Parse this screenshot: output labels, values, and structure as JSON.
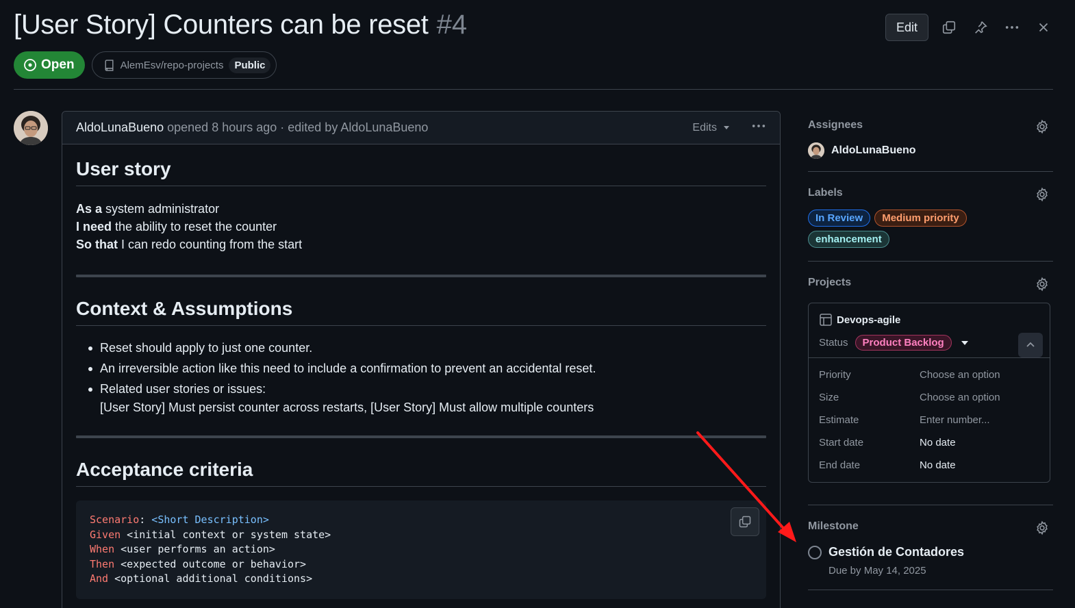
{
  "header": {
    "title": "[User Story] Counters can be reset",
    "number": "#4",
    "edit_label": "Edit",
    "state": "Open",
    "repo": "AlemEsv/repo-projects",
    "visibility": "Public"
  },
  "comment": {
    "author": "AldoLunaBueno",
    "meta": "opened 8 hours ago · edited by AldoLunaBueno",
    "edits_label": "Edits",
    "user_story": {
      "heading": "User story",
      "as_a_kw": "As a",
      "as_a": " system administrator",
      "i_need_kw": "I need",
      "i_need": " the ability to reset the counter",
      "so_that_kw": "So that",
      "so_that": " I can redo counting from the start"
    },
    "context": {
      "heading": "Context & Assumptions",
      "items": [
        "Reset should apply to just one counter.",
        "An irreversible action like this need to include a confirmation to prevent an accidental reset.",
        "Related user stories or issues:"
      ],
      "related": "[User Story] Must persist counter across restarts, [User Story] Must allow multiple counters"
    },
    "acceptance": {
      "heading": "Acceptance criteria",
      "code": {
        "l1_kw": "Scenario",
        "l1_colon": ":",
        "l1_rest": " <Short Description>",
        "l2_kw": "Given",
        "l2_rest": " <initial context or system state>",
        "l3_kw": "When",
        "l3_rest": " <user performs an action>",
        "l4_kw": "Then",
        "l4_rest": " <expected outcome or behavior>",
        "l5_kw": "And",
        "l5_rest": " <optional additional conditions>"
      }
    }
  },
  "sidebar": {
    "assignees": {
      "title": "Assignees",
      "name": "AldoLunaBueno"
    },
    "labels": {
      "title": "Labels",
      "items": [
        {
          "text": "In Review",
          "color": "#58a6ff",
          "bg": "#0d2340",
          "border": "#1f6feb"
        },
        {
          "text": "Medium priority",
          "color": "#ff9e6e",
          "bg": "#3a1e12",
          "border": "#b0532c"
        },
        {
          "text": "enhancement",
          "color": "#a2eeef",
          "bg": "#1b3536",
          "border": "#4a8c8d"
        }
      ]
    },
    "projects": {
      "title": "Projects",
      "name": "Devops-agile",
      "status_label": "Status",
      "status_value": "Product Backlog",
      "fields": [
        {
          "name": "Priority",
          "value": "Choose an option",
          "set": false
        },
        {
          "name": "Size",
          "value": "Choose an option",
          "set": false
        },
        {
          "name": "Estimate",
          "value": "Enter number...",
          "set": false
        },
        {
          "name": "Start date",
          "value": "No date",
          "set": true
        },
        {
          "name": "End date",
          "value": "No date",
          "set": true
        }
      ]
    },
    "milestone": {
      "title": "Milestone",
      "name": "Gestión de Contadores",
      "due": "Due by May 14, 2025"
    }
  },
  "colors": {
    "background": "#0d1117",
    "open_green": "#238636",
    "annotation_arrow": "#ff1a1a"
  }
}
